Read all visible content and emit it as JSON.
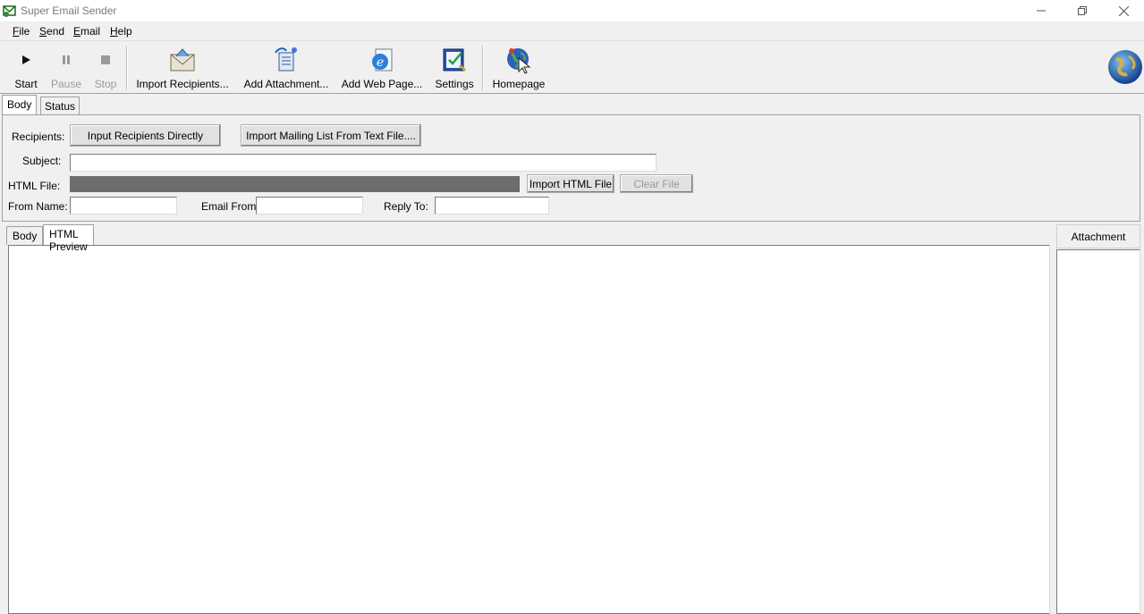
{
  "window": {
    "title": "Super Email Sender"
  },
  "menu": [
    "File",
    "Send",
    "Email",
    "Help"
  ],
  "toolbar": {
    "start": "Start",
    "pause": "Pause",
    "stop": "Stop",
    "import_recipients": "Import Recipients...",
    "add_attachment": "Add Attachment...",
    "add_web_page": "Add Web Page...",
    "settings": "Settings",
    "homepage": "Homepage"
  },
  "top_tabs": [
    "Body",
    "Status"
  ],
  "form": {
    "recipients_label": "Recipients:",
    "input_recipients_button": "Input Recipients Directly",
    "import_mailing_button": "Import Mailing List From Text File....",
    "subject_label": "Subject:",
    "subject_value": "",
    "html_file_label": "HTML File:",
    "html_file_value": "",
    "import_html_button": "Import HTML File",
    "clear_file_button": "Clear File",
    "from_name_label": "From Name:",
    "from_name_value": "",
    "email_from_label": "Email From:",
    "email_from_value": "",
    "reply_to_label": "Reply To:",
    "reply_to_value": ""
  },
  "body_tabs": [
    "Body",
    "HTML Preview"
  ],
  "attachment": {
    "header": "Attachment"
  },
  "colors": {
    "disabled_text": "#9a9a9a",
    "window_bg": "#f0f0f0",
    "readonly_field": "#6d6d6d"
  }
}
